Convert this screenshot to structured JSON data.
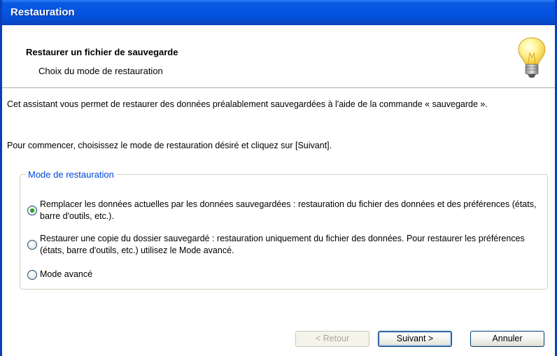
{
  "window": {
    "title": "Restauration"
  },
  "header": {
    "title": "Restaurer un fichier de sauvegarde",
    "subtitle": "Choix du mode de restauration",
    "icon": "lightbulb-icon"
  },
  "content": {
    "intro": "Cet assistant vous permet de restaurer des données préalablement sauvegardées à l'aide de la commande « sauvegarde ».",
    "instruction": "Pour commencer, choisissez le mode de restauration désiré et cliquez sur [Suivant].",
    "group": {
      "legend": "Mode de restauration",
      "options": [
        {
          "label": "Remplacer les données actuelles par les données sauvegardées : restauration du fichier des données et des préférences (états, barre d'outils, etc.).",
          "checked": true
        },
        {
          "label": "Restaurer une copie du dossier sauvegardé : restauration uniquement du fichier des données. Pour restaurer les préférences (états, barre d'outils, etc.) utilisez le Mode avancé.",
          "checked": false
        },
        {
          "label": "Mode avancé",
          "checked": false
        }
      ]
    }
  },
  "buttons": {
    "back": "< Retour",
    "next": "Suivant >",
    "cancel": "Annuler"
  },
  "colors": {
    "titlebar": "#0554e3",
    "legend": "#0046d5",
    "radio_dot": "#21a121"
  }
}
